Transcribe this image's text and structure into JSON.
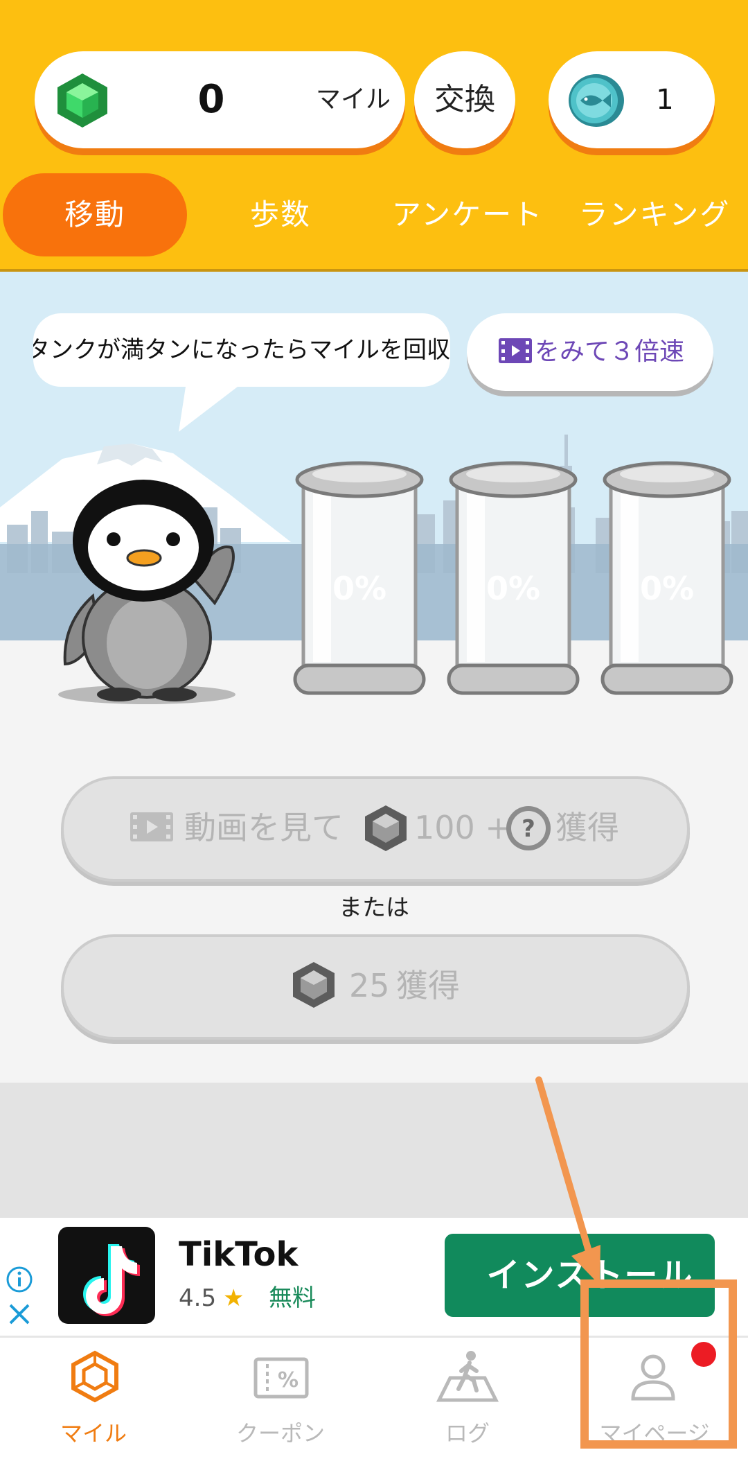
{
  "header": {
    "mile_value": "0",
    "mile_unit": "マイル",
    "exchange_label": "交換",
    "coin_count": "1",
    "tabs": [
      {
        "label": "移動",
        "active": true
      },
      {
        "label": "歩数",
        "active": false
      },
      {
        "label": "アンケート",
        "active": false
      },
      {
        "label": "ランキング",
        "active": false
      }
    ]
  },
  "scene": {
    "bubble_text": "タンクが満タンになったらマイルを回収",
    "speed_button_label": "をみて３倍速",
    "tanks": [
      {
        "percent": "0%"
      },
      {
        "percent": "0%"
      },
      {
        "percent": "0%"
      }
    ]
  },
  "actions": {
    "video_button": {
      "prefix": "動画を見て",
      "amount": "100 +",
      "suffix": "獲得"
    },
    "or_label": "または",
    "coin_button": {
      "amount": "25",
      "suffix": "獲得"
    }
  },
  "ad": {
    "app_name": "TikTok",
    "rating": "4.5",
    "star": "★",
    "price": "無料",
    "install_label": "インストール"
  },
  "nav": {
    "items": [
      {
        "label": "マイル",
        "icon": "hexagon-gem-icon",
        "active": true
      },
      {
        "label": "クーポン",
        "icon": "coupon-icon",
        "active": false
      },
      {
        "label": "ログ",
        "icon": "walking-icon",
        "active": false
      },
      {
        "label": "マイページ",
        "icon": "person-icon",
        "active": false
      }
    ]
  },
  "colors": {
    "header_bg": "#fdbf10",
    "tab_active": "#f8720c",
    "accent_orange": "#f07c11",
    "install_green": "#118a5c",
    "speed_purple": "#6d47b6",
    "annotation_orange": "#f2964f",
    "notification_red": "#ec1c24"
  }
}
